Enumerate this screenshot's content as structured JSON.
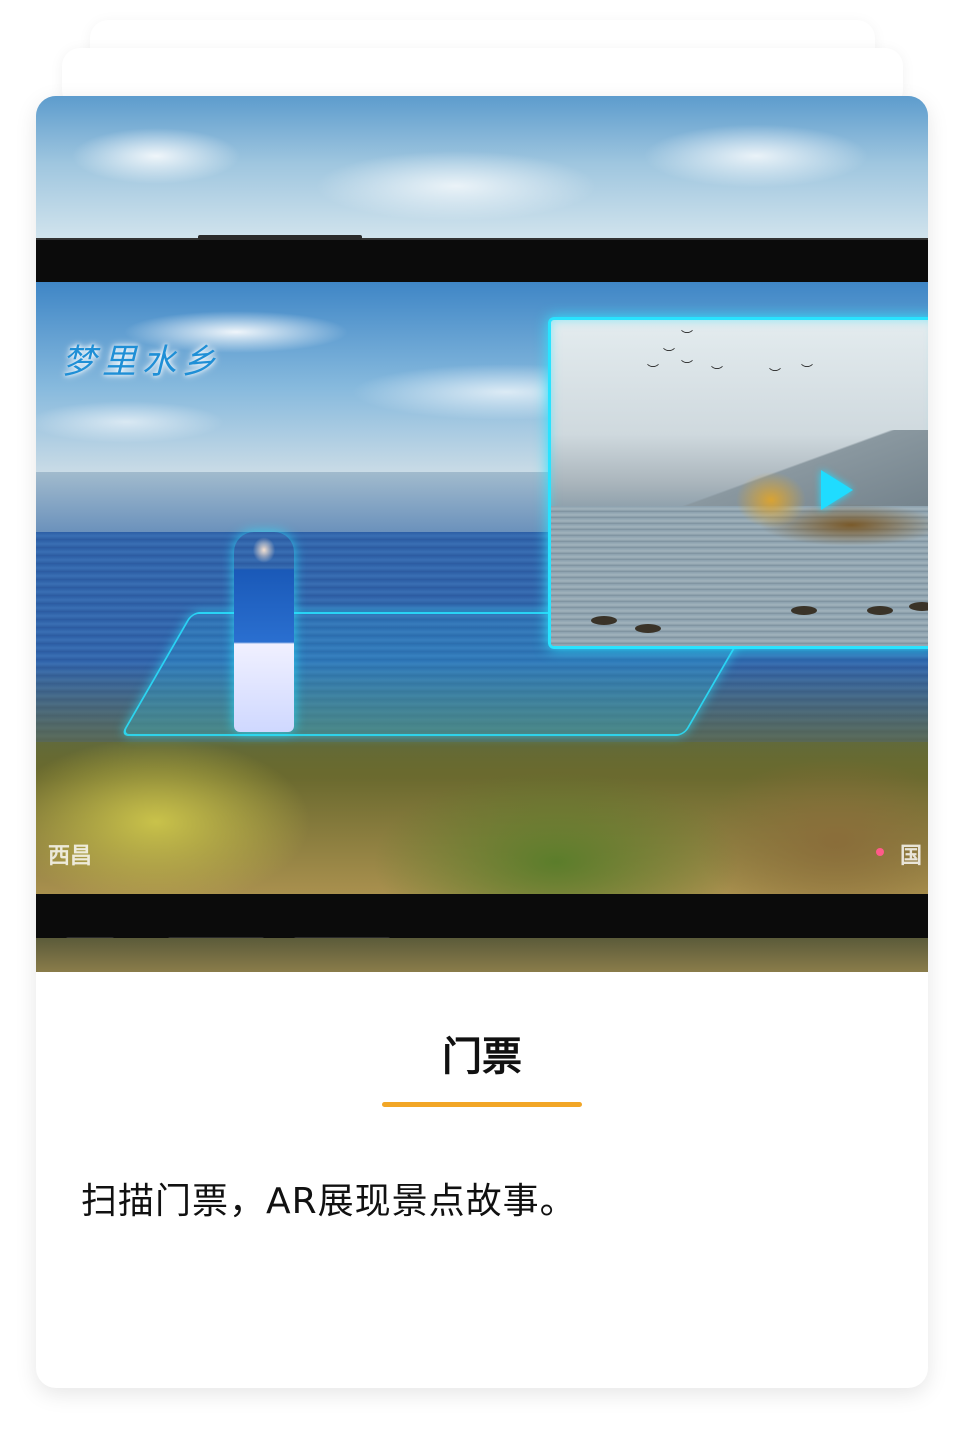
{
  "screen": {
    "brand_overlay_text": "梦里水乡",
    "corner_left_text": "西昌",
    "corner_right_text": "国"
  },
  "card": {
    "title": "门票",
    "description": "扫描门票，AR展现景点故事。",
    "accent_color": "#f2a626"
  },
  "ar_overlay": {
    "frame_color": "#29e3ff",
    "play_icon": "play-icon"
  }
}
